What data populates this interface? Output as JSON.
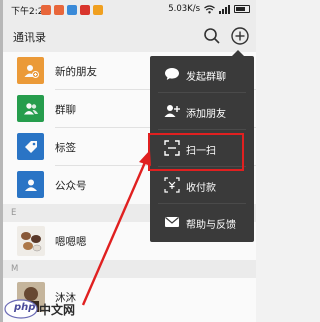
{
  "status_bar": {
    "time": "下午2:28",
    "speed": "5.03K/s",
    "icons": [
      "notification-orange-icon",
      "notification-orange-icon",
      "notification-blue-icon",
      "notification-red-icon",
      "notification-orange-icon"
    ]
  },
  "header": {
    "title": "通讯录",
    "search_icon": "search-icon",
    "add_icon": "plus-circle-icon"
  },
  "contacts": {
    "fixed_items": [
      {
        "label": "新的朋友",
        "icon": "add-friend-icon",
        "color": "#f09e3a"
      },
      {
        "label": "群聊",
        "icon": "group-icon",
        "color": "#27a14f"
      },
      {
        "label": "标签",
        "icon": "tag-icon",
        "color": "#2b77c9"
      },
      {
        "label": "公众号",
        "icon": "official-account-icon",
        "color": "#2b77c9"
      }
    ],
    "sections": [
      {
        "letter": "E",
        "items": [
          {
            "name": "嗯嗯嗯"
          }
        ]
      },
      {
        "letter": "M",
        "items": [
          {
            "name": "沐沐"
          }
        ]
      }
    ]
  },
  "menu": {
    "items": [
      {
        "label": "发起群聊",
        "icon": "chat-bubble-icon"
      },
      {
        "label": "添加朋友",
        "icon": "add-user-icon"
      },
      {
        "label": "扫一扫",
        "icon": "scan-icon",
        "highlighted": true
      },
      {
        "label": "收付款",
        "icon": "payment-icon"
      },
      {
        "label": "帮助与反馈",
        "icon": "mail-icon"
      }
    ],
    "highlight_color": "#e02020"
  },
  "watermark": {
    "text": "中文网",
    "logo_text": "php"
  }
}
